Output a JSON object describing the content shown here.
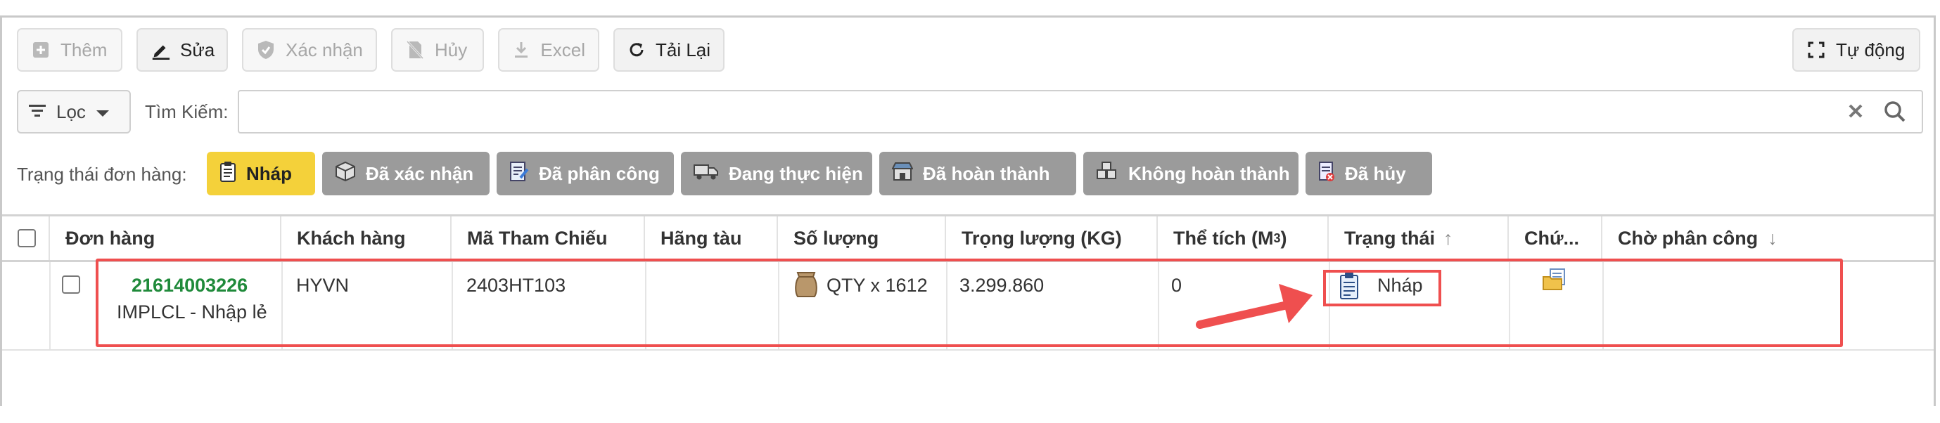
{
  "toolbar": {
    "add_label": "Thêm",
    "edit_label": "Sửa",
    "confirm_label": "Xác nhận",
    "cancel_label": "Hủy",
    "excel_label": "Excel",
    "reload_label": "Tải Lại",
    "auto_label": "Tự động"
  },
  "filter": {
    "filter_label": "Lọc",
    "search_label": "Tìm Kiếm:",
    "search_value": ""
  },
  "status_filter": {
    "label": "Trạng thái đơn hàng:",
    "chips": [
      {
        "label": "Nháp"
      },
      {
        "label": "Đã xác nhận"
      },
      {
        "label": "Đã phân công"
      },
      {
        "label": "Đang thực hiện"
      },
      {
        "label": "Đã hoàn thành"
      },
      {
        "label": "Không hoàn thành"
      },
      {
        "label": "Đã hủy"
      }
    ]
  },
  "table": {
    "columns": {
      "order": "Đơn hàng",
      "customer": "Khách hàng",
      "reference": "Mã Tham Chiếu",
      "carrier": "Hãng tàu",
      "quantity": "Số lượng",
      "weight": "Trọng lượng (KG)",
      "volume": "Thể tích (M",
      "volume_sup": "3",
      "volume_close": ")",
      "status": "Trạng thái",
      "status_sort": "↑",
      "docs": "Chứ...",
      "assign": "Chờ phân công",
      "assign_sort": "↓"
    },
    "rows": [
      {
        "order_code": "21614003226",
        "order_type": "IMPLCL - Nhập lẻ",
        "customer": "HYVN",
        "reference": "2403HT103",
        "carrier": "",
        "quantity": "QTY x 1612",
        "weight": "3.299.860",
        "volume": "0",
        "status": "Nháp"
      }
    ]
  },
  "colors": {
    "highlight": "#ef4f4f",
    "active_chip": "#f4d13a",
    "inactive_chip": "#9b9b9b",
    "order_code": "#1f8a3a"
  }
}
